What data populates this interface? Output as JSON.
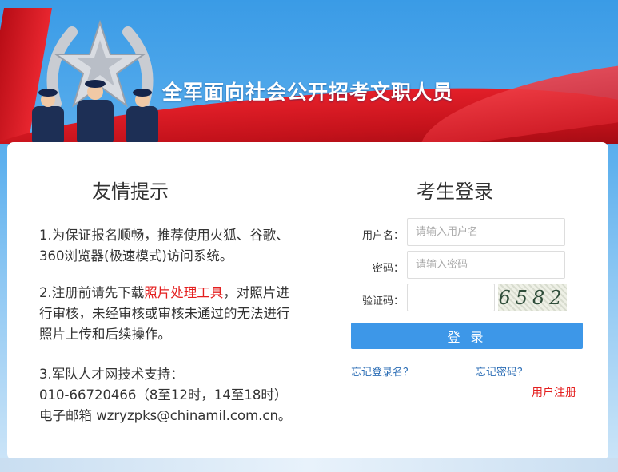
{
  "header": {
    "site_title": "全军面向社会公开招考文职人员"
  },
  "notice": {
    "title": "友情提示",
    "tip1": "1.为保证报名顺畅，推荐使用火狐、谷歌、360浏览器(极速模式)访问系统。",
    "tip2_pre": "2.注册前请先下载",
    "tip2_link": "照片处理工具",
    "tip2_post": "，对照片进行审核，未经审核或审核未通过的无法进行照片上传和后续操作。",
    "tip3_line1": "3.军队人才网技术支持：",
    "tip3_line2": "010-66720466（8至12时，14至18时）",
    "tip3_line3": "电子邮箱 wzryzpks@chinamil.com.cn。"
  },
  "login": {
    "title": "考生登录",
    "username_label": "用户名：",
    "username_placeholder": "请输入用户名",
    "password_label": "密码：",
    "password_placeholder": "请输入密码",
    "captcha_label": "验证码：",
    "captcha_text": "6582",
    "submit_label": "登 录",
    "forgot_username": "忘记登录名？",
    "forgot_password": "忘记密码？",
    "register": "用户注册"
  },
  "colors": {
    "primary_blue": "#3d97e8",
    "accent_red": "#e41f1f",
    "link_blue": "#2b6db5"
  }
}
